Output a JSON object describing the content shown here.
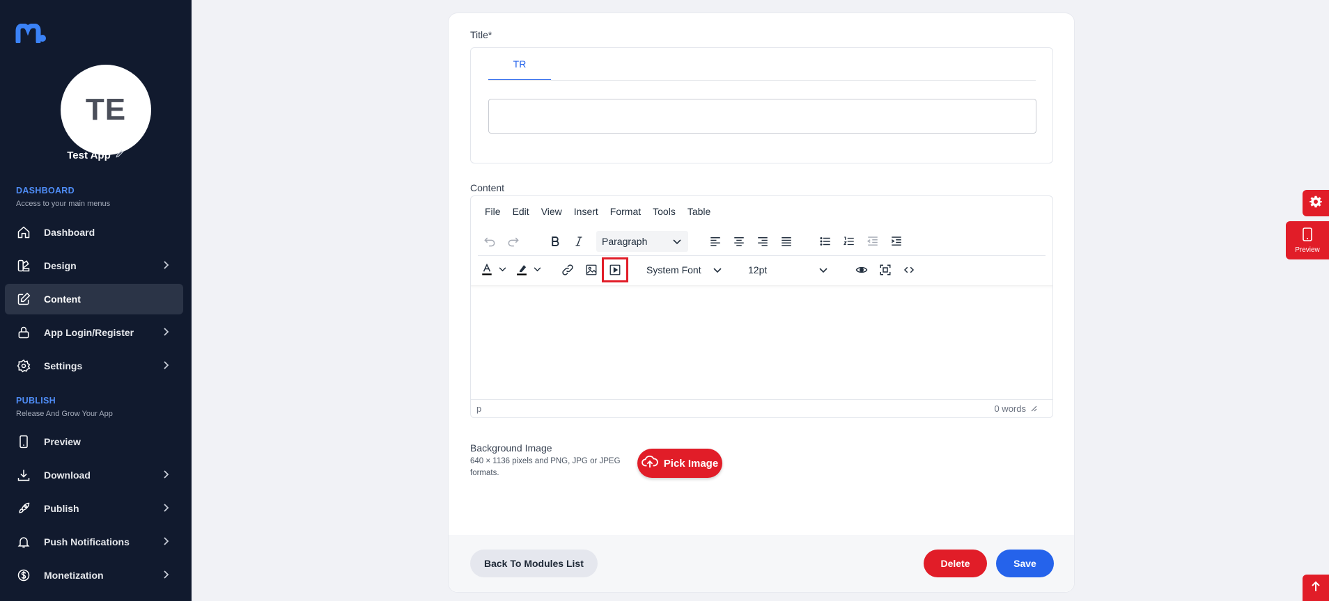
{
  "colors": {
    "sidebar": "#111a2e",
    "accent_blue": "#2563eb",
    "accent_red": "#e11d28"
  },
  "sidebar": {
    "avatar_initials": "TE",
    "app_name": "Test App",
    "dashboard_section": {
      "title": "DASHBOARD",
      "subtitle": "Access to your main menus"
    },
    "publish_section": {
      "title": "PUBLISH",
      "subtitle": "Release And Grow Your App"
    },
    "items": [
      {
        "label": "Dashboard",
        "icon": "home-icon"
      },
      {
        "label": "Design",
        "icon": "palette-icon"
      },
      {
        "label": "Content",
        "icon": "edit-icon",
        "active": true
      },
      {
        "label": "App Login/Register",
        "icon": "lock-icon"
      },
      {
        "label": "Settings",
        "icon": "gear-icon"
      },
      {
        "label": "Preview",
        "icon": "phone-icon"
      },
      {
        "label": "Download",
        "icon": "download-icon"
      },
      {
        "label": "Publish",
        "icon": "rocket-icon"
      },
      {
        "label": "Push Notifications",
        "icon": "bell-icon"
      },
      {
        "label": "Monetization",
        "icon": "dollar-icon"
      }
    ]
  },
  "form": {
    "title_label": "Title*",
    "lang_tab": "TR",
    "title_value": "",
    "content_label": "Content",
    "editor": {
      "menu": [
        "File",
        "Edit",
        "View",
        "Insert",
        "Format",
        "Tools",
        "Table"
      ],
      "block_format": "Paragraph",
      "font_family": "System Font",
      "font_size": "12pt",
      "status_path": "p",
      "word_count": "0 words"
    },
    "bg_image_title": "Background Image",
    "bg_image_hint": "640 × 1136 pixels and PNG, JPG or JPEG formats.",
    "pick_image_label": "Pick Image"
  },
  "footer": {
    "back_label": "Back To Modules List",
    "delete_label": "Delete",
    "save_label": "Save"
  },
  "floating": {
    "preview_label": "Preview"
  }
}
